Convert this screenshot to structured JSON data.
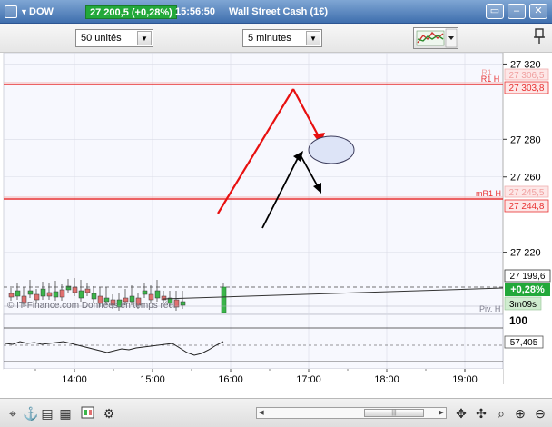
{
  "window": {
    "ticker": "DOW",
    "quote": "27 200,5 (+0,28%)",
    "time": "15:56:50",
    "instrument": "Wall Street Cash (1€)"
  },
  "toolbar": {
    "units": {
      "value": "50 unités"
    },
    "timeframe": {
      "value": "5 minutes"
    }
  },
  "chart_data": {
    "type": "candlestick",
    "price_axis": {
      "range": [
        27187,
        27326
      ],
      "ticks": [
        "27 320",
        "27 280",
        "27 260",
        "27 220"
      ]
    },
    "time_axis": {
      "ticks": [
        "14:00",
        "15:00",
        "16:00",
        "17:00",
        "18:00",
        "19:00"
      ]
    },
    "levels": [
      {
        "name": "R1 H",
        "price": 27303.8,
        "label": "27 303,8",
        "color": "#e83030"
      },
      {
        "name": "mR1 H",
        "price": 27244.8,
        "label": "27 244,8",
        "color": "#e83030"
      }
    ],
    "faint_levels": [
      {
        "name": "R1",
        "label": "27 306,5"
      },
      {
        "name": "mR1 H",
        "label": "27 245,5"
      }
    ],
    "current_price": {
      "label": "27 199,6"
    },
    "change_badge": "+0,28%",
    "countdown_badge": "3m09s",
    "watermark": "© IT-Finance.com  Données en temps réel",
    "pivot_label": "Piv. H",
    "oscillator": {
      "top_label": "100",
      "value_label": "57,405"
    }
  },
  "colors": {
    "level_line": "#e83030",
    "up_candle": "#3bb54a",
    "down_candle": "#e07070",
    "arrow_red": "#e81010",
    "arrow_black": "#000000",
    "ellipse_fill": "#dde4f7"
  },
  "icons": [
    "chart-type-icon",
    "zoom-in-icon",
    "zoom-out-icon",
    "search-icon",
    "drawing-tools-icon",
    "scroll-left-icon",
    "scroll-right-icon"
  ]
}
